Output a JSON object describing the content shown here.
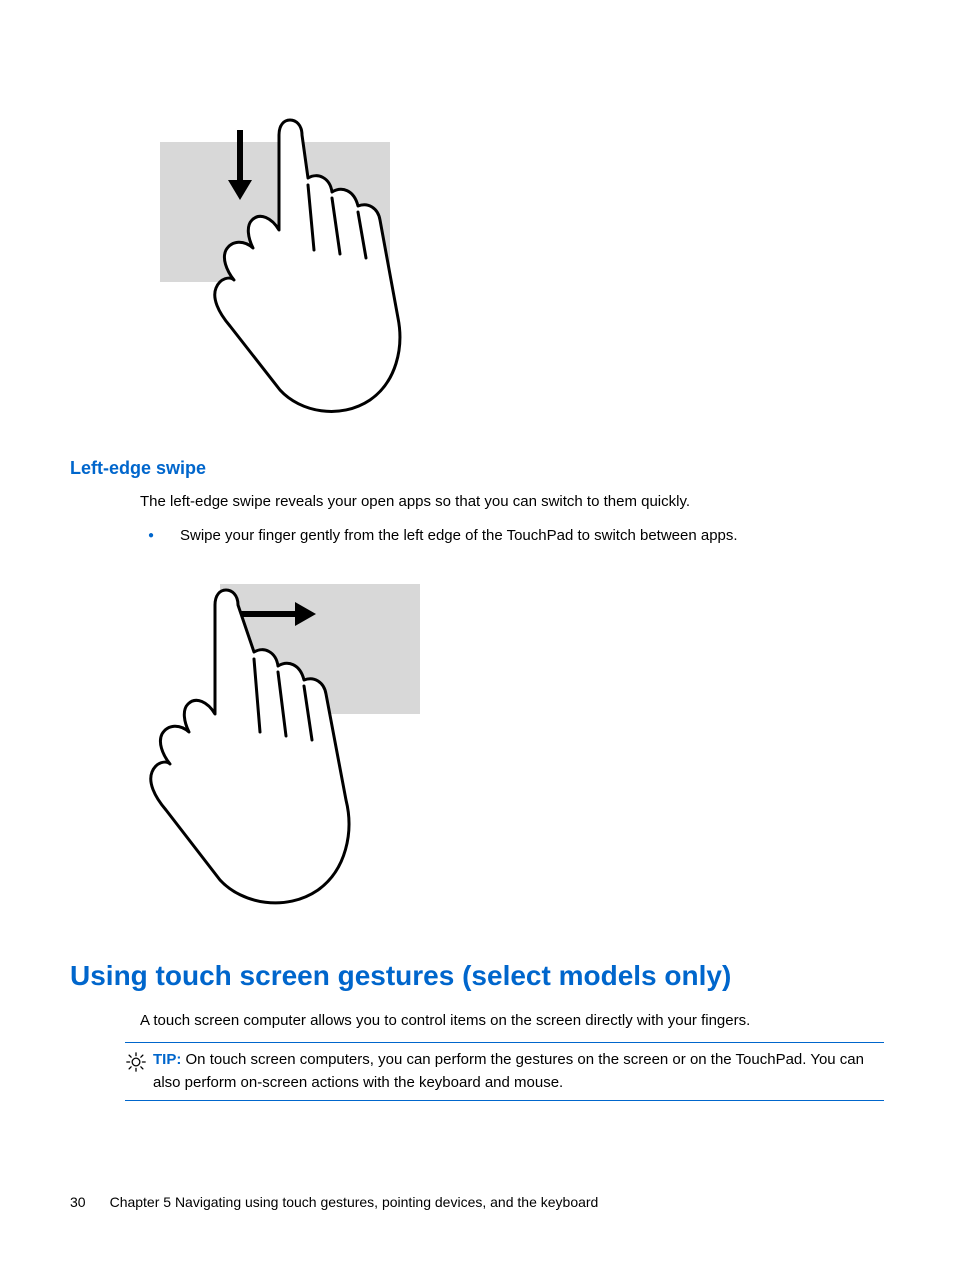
{
  "section_left_edge": {
    "heading": "Left-edge swipe",
    "intro": "The left-edge swipe reveals your open apps so that you can switch to them quickly.",
    "bullet": "Swipe your finger gently from the left edge of the TouchPad to switch between apps."
  },
  "section_touch_screen": {
    "heading": "Using touch screen gestures (select models only)",
    "intro": "A touch screen computer allows you to control items on the screen directly with your fingers.",
    "tip_label": "TIP:",
    "tip_text": "On touch screen computers, you can perform the gestures on the screen or on the TouchPad. You can also perform on-screen actions with the keyboard and mouse."
  },
  "footer": {
    "page_number": "30",
    "chapter": "Chapter 5   Navigating using touch gestures, pointing devices, and the keyboard"
  }
}
